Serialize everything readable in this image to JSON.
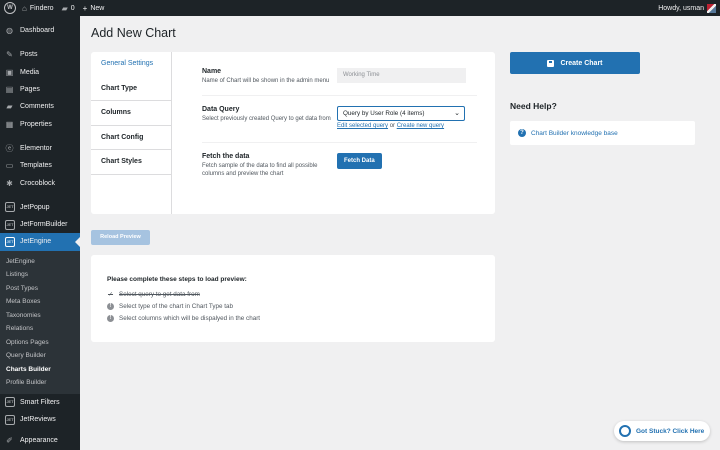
{
  "adminbar": {
    "site_name": "Findero",
    "comments_count": "0",
    "new_label": "New",
    "greeting": "Howdy, usman"
  },
  "sidebar": {
    "main_items": [
      {
        "label": "Dashboard",
        "icon": "dashboard-icon"
      },
      {
        "label": "Posts",
        "icon": "pin-icon"
      },
      {
        "label": "Media",
        "icon": "media-icon"
      },
      {
        "label": "Pages",
        "icon": "pages-icon"
      },
      {
        "label": "Comments",
        "icon": "comment-icon"
      },
      {
        "label": "Properties",
        "icon": "properties-icon"
      },
      {
        "label": "Elementor",
        "icon": "elementor-icon"
      },
      {
        "label": "Templates",
        "icon": "templates-icon"
      },
      {
        "label": "Crocoblock",
        "icon": "crocoblock-icon"
      }
    ],
    "jet_items": [
      {
        "label": "JetPopup"
      },
      {
        "label": "JetFormBuilder"
      },
      {
        "label": "JetEngine"
      }
    ],
    "jet_icon_text": "JET",
    "sub_items": [
      "JetEngine",
      "Listings",
      "Post Types",
      "Meta Boxes",
      "Taxonomies",
      "Relations",
      "Options Pages",
      "Query Builder",
      "Charts Builder",
      "Profile Builder"
    ],
    "after_items": [
      {
        "label": "Smart Filters"
      },
      {
        "label": "JetReviews"
      }
    ],
    "appearance_label": "Appearance"
  },
  "page": {
    "title": "Add New Chart"
  },
  "tabs": [
    "General Settings",
    "Chart Type",
    "Columns",
    "Chart Config",
    "Chart Styles"
  ],
  "fields": {
    "name": {
      "label": "Name",
      "desc": "Name of Chart will be shown in the admin menu",
      "value": "Working Time"
    },
    "query": {
      "label": "Data Query",
      "desc": "Select previously created Query to get data from",
      "selected": "Query by User Role (4 items)",
      "edit_link": "Edit selected query",
      "or_text": " or ",
      "create_link": "Create new query"
    },
    "fetch": {
      "label": "Fetch the data",
      "desc": "Fetch sample of the data to find all possible columns and preview the chart",
      "button": "Fetch Data"
    }
  },
  "actions": {
    "create": "Create Chart",
    "reload": "Reload Preview"
  },
  "help": {
    "title": "Need Help?",
    "link": "Chart Builder knowledge base"
  },
  "preview": {
    "heading": "Please complete these steps to load preview:",
    "steps": [
      {
        "text": "Select query to get data from",
        "done": true
      },
      {
        "text": "Select type of the chart in Chart Type tab",
        "done": false
      },
      {
        "text": "Select columns which will be dispalyed in the chart",
        "done": false
      }
    ]
  },
  "stuck": {
    "label": "Got Stuck? Click Here"
  },
  "colors": {
    "accent": "#2271b1",
    "sidebar_bg": "#1d2327",
    "page_bg": "#f0f0f1"
  }
}
